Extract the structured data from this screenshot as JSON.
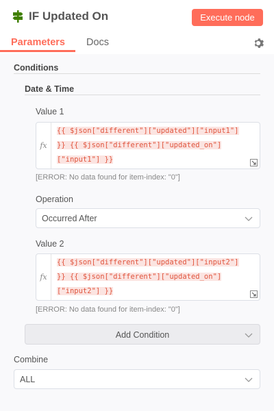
{
  "header": {
    "title": "IF Updated On",
    "execute_label": "Execute node"
  },
  "tabs": {
    "parameters": "Parameters",
    "docs": "Docs"
  },
  "conditions": {
    "section_label": "Conditions",
    "group_label": "Date & Time",
    "value1": {
      "label": "Value 1",
      "fx": "fx",
      "lines": [
        "{{ $json[\"different\"][\"updated\"][\"input1\"]",
        "}} {{ $json[\"different\"][\"updated_on\"]",
        "[\"input1\"] }}"
      ],
      "error": "[ERROR: No data found for item-index: \"0\"]"
    },
    "operation": {
      "label": "Operation",
      "value": "Occurred After"
    },
    "value2": {
      "label": "Value 2",
      "fx": "fx",
      "lines": [
        "{{ $json[\"different\"][\"updated\"][\"input2\"]",
        "}} {{ $json[\"different\"][\"updated_on\"]",
        "[\"input2\"] }}"
      ],
      "error": "[ERROR: No data found for item-index: \"0\"]"
    },
    "add_condition_label": "Add Condition"
  },
  "combine": {
    "label": "Combine",
    "value": "ALL"
  },
  "colors": {
    "accent": "#ff6d5a",
    "node_icon": "#408000",
    "expression_text": "#e0553e",
    "expression_bg": "#fbe4e1"
  },
  "icons": {
    "node": "signpost-icon",
    "settings": "gear-icon",
    "dropdown": "chevron-down-icon",
    "resize": "expand-icon"
  }
}
